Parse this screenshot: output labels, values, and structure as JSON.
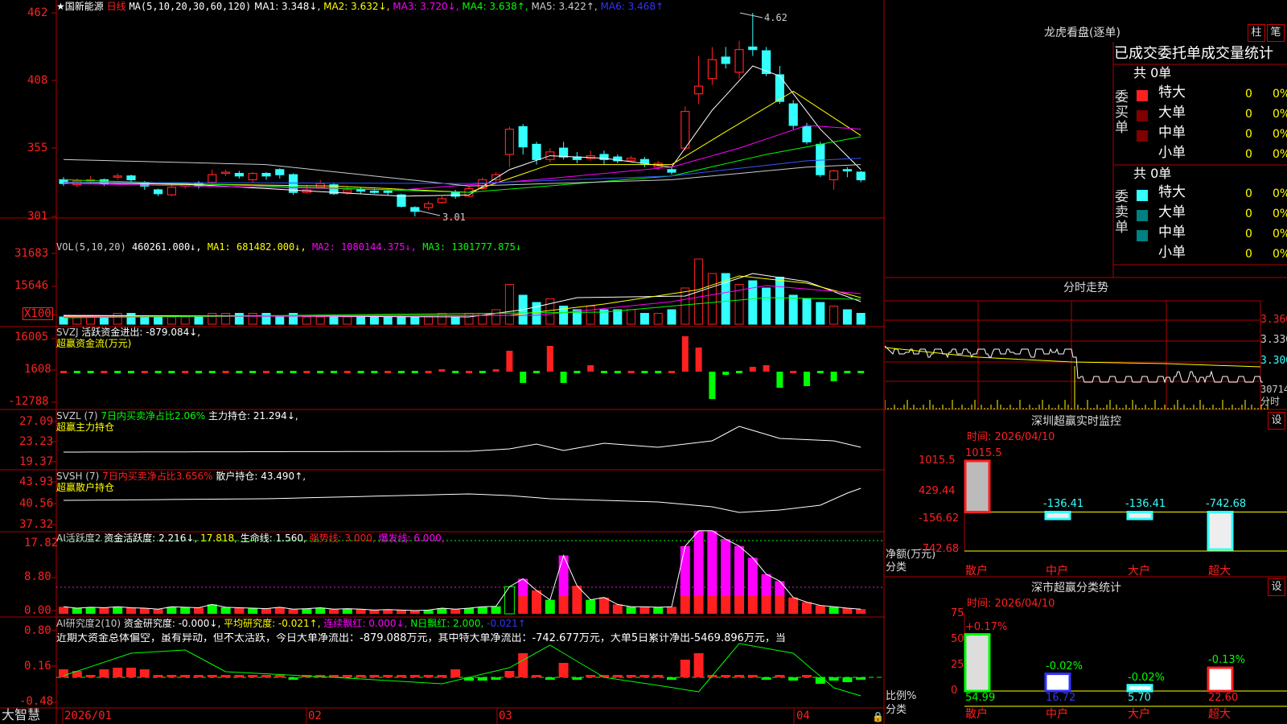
{
  "colors": {
    "red": "#ff2020",
    "cyan": "#33ffff",
    "green": "#00ff00",
    "white": "#ffffff",
    "yellow": "#ffff00",
    "magenta": "#ff00ff",
    "blue": "#3333ff",
    "gray": "#aaaaaa",
    "frame": "#b00000"
  },
  "kline": {
    "star": "★",
    "name": "国新能源",
    "period": "日线",
    "ma_label": "MA(5,10,20,30,60,120)",
    "ma1": "MA1: 3.348↓,",
    "ma2": "MA2: 3.632↓,",
    "ma3": "MA3: 3.720↓,",
    "ma4": "MA4: 3.638↑,",
    "ma5": "MA5: 3.422↑,",
    "ma6": "MA6: 3.468↑",
    "y_ticks": [
      "462",
      "408",
      "355",
      "301"
    ],
    "high_label": "4.62",
    "low_label": "3.01"
  },
  "vol": {
    "label": "VOL(5,10,20)",
    "value": "460261.000↓,",
    "ma1": "MA1: 681482.000↓,",
    "ma2": "MA2: 1080144.375↓,",
    "ma3": "MA3: 1301777.875↓",
    "y_ticks": [
      "31683",
      "15646"
    ],
    "unit": "X100"
  },
  "svzj": {
    "code": "SVZJ",
    "label": "活跃资金进出: -879.084↓,",
    "sub": "超赢资金流(万元)",
    "y_ticks": [
      "16005",
      "1608",
      "-12788"
    ]
  },
  "svzl": {
    "label": "SVZL (7)",
    "pct": "7日内买卖净占比2.06%",
    "hold": "主力持仓: 21.294↓,",
    "sub": "超赢主力持仓",
    "y_ticks": [
      "27.09",
      "23.23",
      "19.37"
    ]
  },
  "svsh": {
    "label": "SVSH (7)",
    "pct": "7日内买卖净占比3.656%",
    "hold": "散户持仓: 43.490↑,",
    "sub": "超赢散户持仓",
    "y_ticks": [
      "43.93",
      "40.56",
      "37.32"
    ]
  },
  "ai1": {
    "label": "AI活跃度2",
    "a": "资金活跃度: 2.216↓,",
    "b": "17.818,",
    "c": "生命线: 1.560,",
    "d": "强势线: 3.000,",
    "e": "爆发线: 6.000,",
    "y_ticks": [
      "17.82",
      "8.80",
      "0.00"
    ]
  },
  "ai2": {
    "label": "AI研究度2(10)",
    "a": "资金研究度: -0.000↓,",
    "b": "平均研究度: -0.021↑,",
    "c": "连续飘红: 0.000↓,",
    "d": "N日飘红: 2.000,",
    "e": "-0.021↑",
    "note": "近期大资金总体偏空，虽有异动，但不太活跃，今日大单净流出：-879.088万元，其中特大单净流出：-742.677万元，大单5日累计净出-5469.896万元，当",
    "y_ticks": [
      "0.80",
      "0.16",
      "-0.48"
    ]
  },
  "xaxis": {
    "brand": "大智慧",
    "labels": [
      "2026/01",
      "02",
      "03",
      "04"
    ]
  },
  "panel": {
    "title": "龙虎看盘(逐单)",
    "btn1": "柱",
    "btn2": "笔",
    "tabs": "已成交委托单成交量统计",
    "buy": {
      "side": "委买单",
      "count": "共 0单",
      "rows": [
        {
          "name": "特大",
          "v": "0",
          "p": "0%"
        },
        {
          "name": "大单",
          "v": "0",
          "p": "0%"
        },
        {
          "name": "中单",
          "v": "0",
          "p": "0%"
        },
        {
          "name": "小单",
          "v": "0",
          "p": "0%"
        }
      ]
    },
    "sell": {
      "side": "委卖单",
      "count": "共 0单",
      "rows": [
        {
          "name": "特大",
          "v": "0",
          "p": "0%"
        },
        {
          "name": "大单",
          "v": "0",
          "p": "0%"
        },
        {
          "name": "中单",
          "v": "0",
          "p": "0%"
        },
        {
          "name": "小单",
          "v": "0",
          "p": "0%"
        }
      ]
    }
  },
  "intraday": {
    "title": "分时走势",
    "prices": [
      "3.360",
      "3.330",
      "3.300"
    ],
    "vol": "30714",
    "vol_label": "分时"
  },
  "monitor": {
    "title": "深圳超赢实时监控",
    "btn": "设",
    "time": "时间: 2026/04/10",
    "ylabel": "净额(万元)",
    "xlabel": "分类",
    "y_ticks": [
      "1015.5",
      "429.44",
      "-156.62",
      "-742.68"
    ],
    "cats": [
      "散户",
      "中户",
      "大户",
      "超大"
    ],
    "values": [
      1015.5,
      -136.41,
      -136.41,
      -742.68
    ],
    "value_labels": [
      "1015.5",
      "-136.41",
      "-136.41",
      "-742.68"
    ]
  },
  "classstat": {
    "title": "深市超赢分类统计",
    "btn": "设",
    "time": "时间: 2026/04/10",
    "ylabel": "比例%",
    "xlabel": "分类",
    "y_ticks": [
      "75",
      "50",
      "25",
      "0"
    ],
    "cats": [
      "散户",
      "中户",
      "大户",
      "超大"
    ],
    "values": [
      54.99,
      16.72,
      5.7,
      22.6
    ],
    "value_labels": [
      "54.99",
      "16.72",
      "5.70",
      "22.60"
    ],
    "change_labels": [
      "+0.17%",
      "-0.02%",
      "-0.02%",
      "-0.13%"
    ]
  },
  "chart_data": {
    "type": "bar",
    "title": "深圳超赢实时监控",
    "categories": [
      "散户",
      "中户",
      "大户",
      "超大"
    ],
    "values": [
      1015.5,
      -136.41,
      -136.41,
      -742.68
    ],
    "ylabel": "净额(万元)",
    "ylim": [
      -742.68,
      1015.5
    ]
  }
}
